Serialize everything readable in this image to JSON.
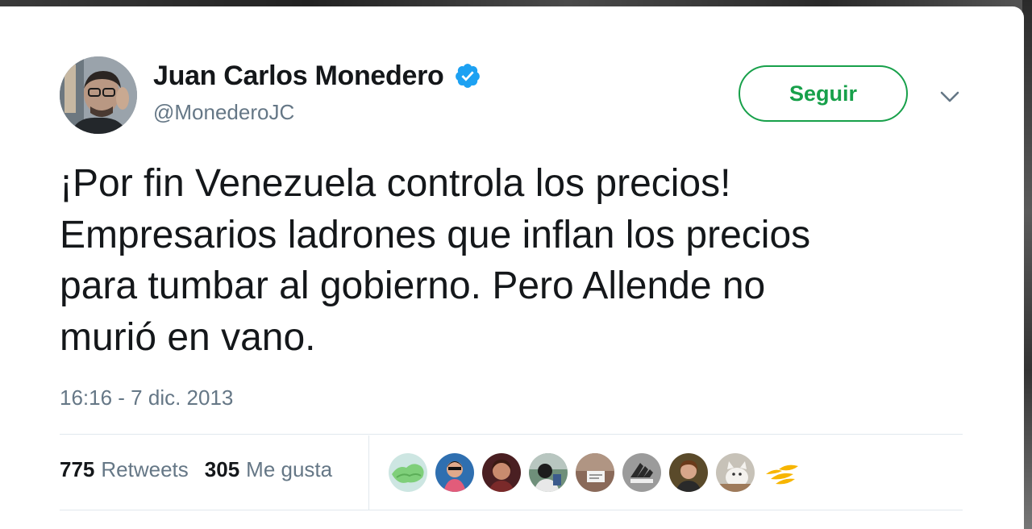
{
  "author": {
    "display_name": "Juan Carlos Monedero",
    "handle": "@MonederoJC",
    "verified": true,
    "avatar_icon": "user-avatar-photo"
  },
  "actions": {
    "follow_label": "Seguir",
    "menu_icon": "chevron-down-icon"
  },
  "tweet": {
    "text": "¡Por fin Venezuela controla los precios!\nEmpresarios ladrones que inflan los precios\npara tumbar al gobierno. Pero Allende no\nmurió en vano.",
    "timestamp": "16:16 - 7 dic. 2013"
  },
  "stats": {
    "retweets_count": "775",
    "retweets_label": "Retweets",
    "likes_count": "305",
    "likes_label": "Me gusta"
  },
  "likers": [
    {
      "icon": "map-avatar"
    },
    {
      "icon": "person-avatar"
    },
    {
      "icon": "person-avatar"
    },
    {
      "icon": "person-avatar"
    },
    {
      "icon": "sign-avatar"
    },
    {
      "icon": "logo-avatar"
    },
    {
      "icon": "person-avatar"
    },
    {
      "icon": "cat-avatar"
    },
    {
      "icon": "bird-logo-avatar"
    }
  ],
  "colors": {
    "follow_green": "#17a04a",
    "verified_blue": "#1da1f2",
    "secondary_text": "#657786",
    "primary_text": "#14171a"
  }
}
